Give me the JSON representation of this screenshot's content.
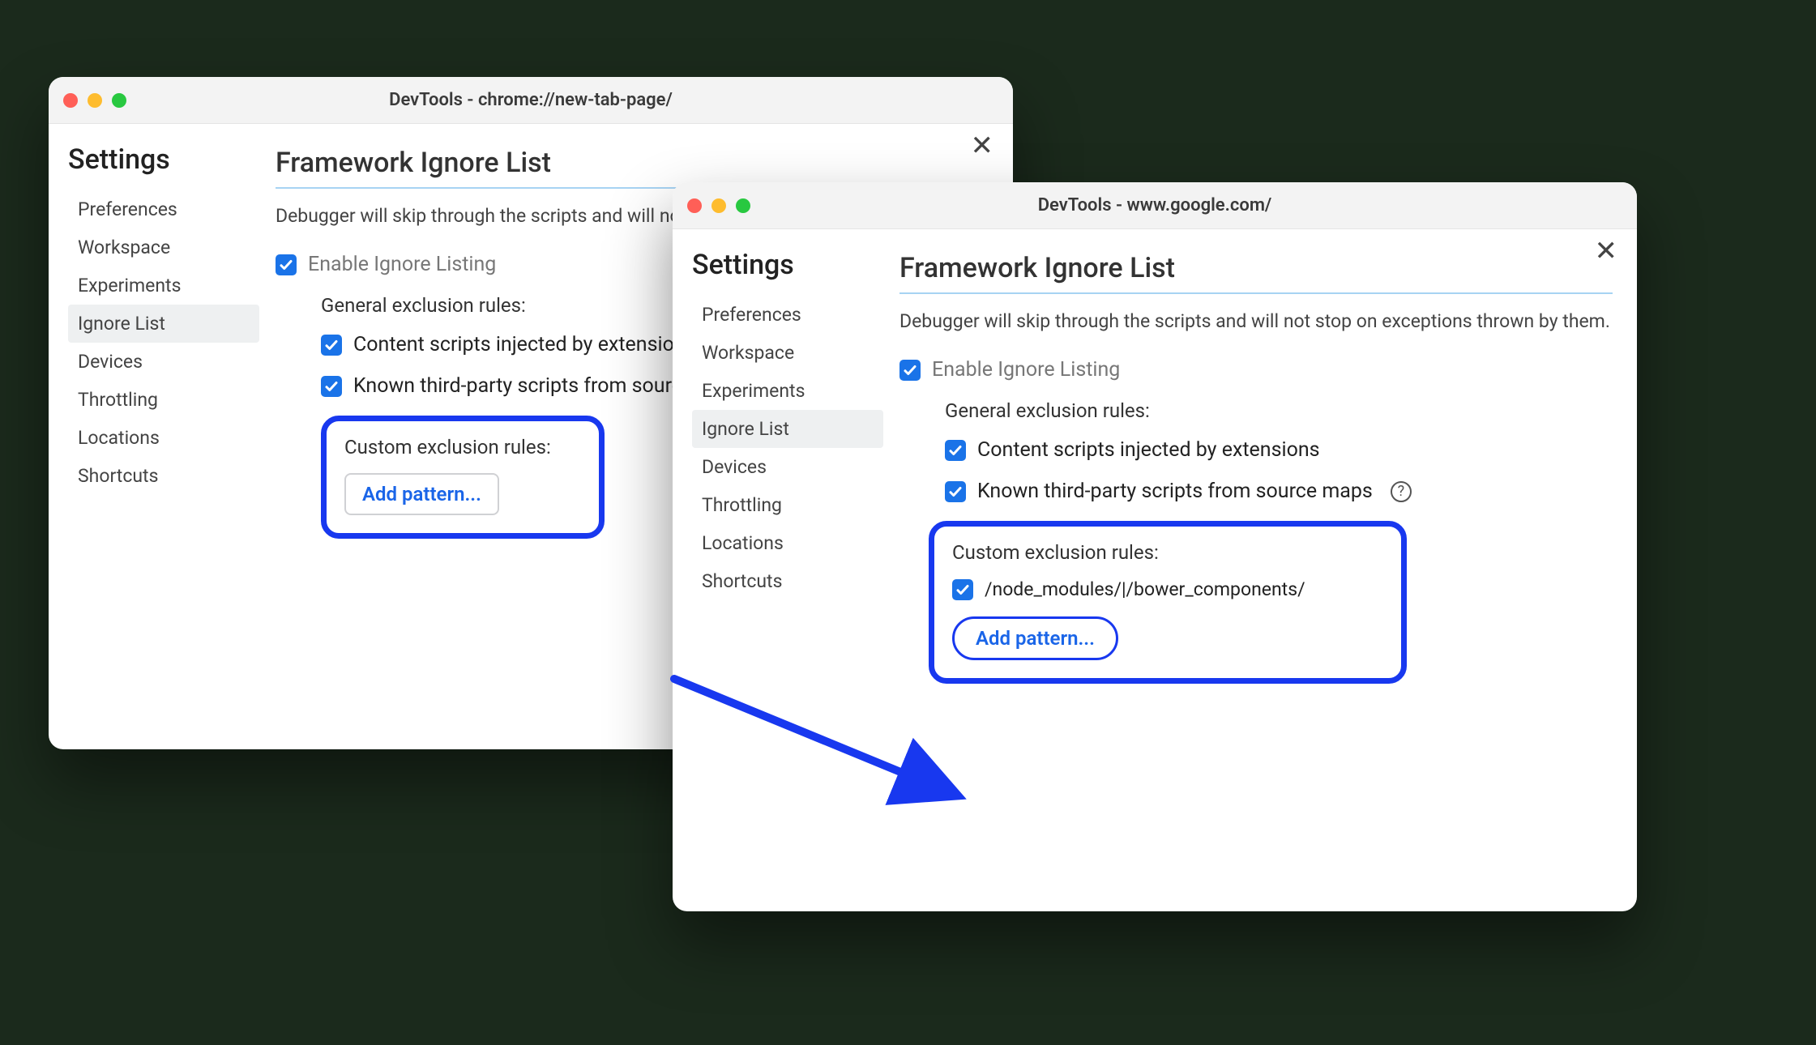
{
  "window1": {
    "title": "DevTools - chrome://new-tab-page/",
    "settings_heading": "Settings",
    "nav": [
      "Preferences",
      "Workspace",
      "Experiments",
      "Ignore List",
      "Devices",
      "Throttling",
      "Locations",
      "Shortcuts"
    ],
    "nav_active_index": 3,
    "panel_heading": "Framework Ignore List",
    "description": "Debugger will skip through the scripts and will not stop on exceptions thrown by them.",
    "enable_label": "Enable Ignore Listing",
    "general_rules_label": "General exclusion rules:",
    "rule_content_scripts": "Content scripts injected by extensions",
    "rule_third_party": "Known third-party scripts from source maps",
    "custom_rules_label": "Custom exclusion rules:",
    "add_pattern_label": "Add pattern..."
  },
  "window2": {
    "title": "DevTools - www.google.com/",
    "settings_heading": "Settings",
    "nav": [
      "Preferences",
      "Workspace",
      "Experiments",
      "Ignore List",
      "Devices",
      "Throttling",
      "Locations",
      "Shortcuts"
    ],
    "nav_active_index": 3,
    "panel_heading": "Framework Ignore List",
    "description": "Debugger will skip through the scripts and will not stop on exceptions thrown by them.",
    "enable_label": "Enable Ignore Listing",
    "general_rules_label": "General exclusion rules:",
    "rule_content_scripts": "Content scripts injected by extensions",
    "rule_third_party": "Known third-party scripts from source maps",
    "custom_rules_label": "Custom exclusion rules:",
    "custom_pattern": "/node_modules/|/bower_components/",
    "add_pattern_label": "Add pattern..."
  },
  "colors": {
    "accent": "#1a73e8",
    "callout_border": "#1838ef"
  }
}
